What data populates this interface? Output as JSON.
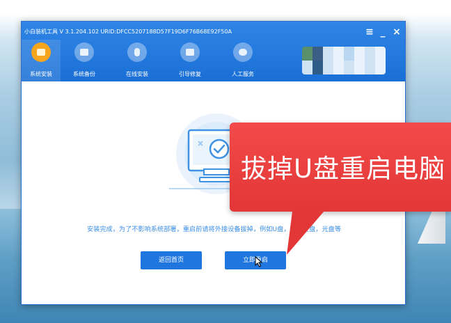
{
  "window": {
    "title": "小白装机工具 V 3.1.204.102 URID:DFCC5207188D57F19D6F76B68E92F50A",
    "menu_glyph": "≡",
    "minimize_glyph": "_",
    "close_glyph": "×"
  },
  "nav": {
    "items": [
      {
        "label": "系统安装",
        "icon": "system-install-icon",
        "active": true
      },
      {
        "label": "系统备份",
        "icon": "system-backup-icon",
        "active": false
      },
      {
        "label": "在线安装",
        "icon": "online-install-icon",
        "active": false
      },
      {
        "label": "引导修复",
        "icon": "boot-repair-icon",
        "active": false
      },
      {
        "label": "人工服务",
        "icon": "chat-service-icon",
        "active": false
      }
    ]
  },
  "main": {
    "status_text": "安装完成，为了不影响系统部署，重启前请将外接设备拔掉，例如U盘，移动硬盘，光盘等",
    "back_button": "返回首页",
    "restart_button": "立即重启"
  },
  "callout": {
    "text": "拔掉U盘重启电脑"
  },
  "colors": {
    "titlebar": "#1a6fd6",
    "accent_orange": "#f7a51c",
    "button_blue": "#1f76de",
    "status_text": "#3a8ee6",
    "callout_red": "#e33636"
  }
}
